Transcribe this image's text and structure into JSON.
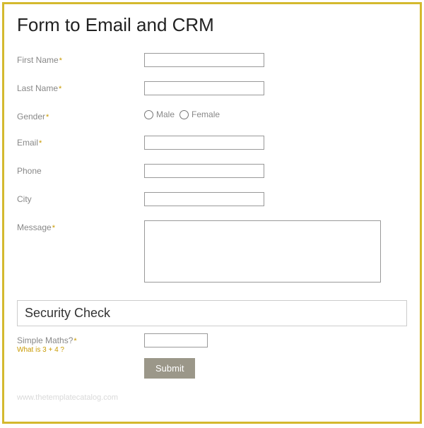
{
  "title": "Form to Email and CRM",
  "fields": {
    "firstName": {
      "label": "First Name",
      "required": true
    },
    "lastName": {
      "label": "Last Name",
      "required": true
    },
    "gender": {
      "label": "Gender",
      "required": true,
      "options": {
        "male": "Male",
        "female": "Female"
      }
    },
    "email": {
      "label": "Email",
      "required": true
    },
    "phone": {
      "label": "Phone",
      "required": false
    },
    "city": {
      "label": "City",
      "required": false
    },
    "message": {
      "label": "Message",
      "required": true
    }
  },
  "security": {
    "header": "Security Check",
    "maths": {
      "label": "Simple Maths?",
      "required": true,
      "hint": "What is 3 + 4 ?"
    }
  },
  "submit": {
    "label": "Submit"
  },
  "requiredMark": "*",
  "watermark": "www.thetemplatecatalog.com"
}
